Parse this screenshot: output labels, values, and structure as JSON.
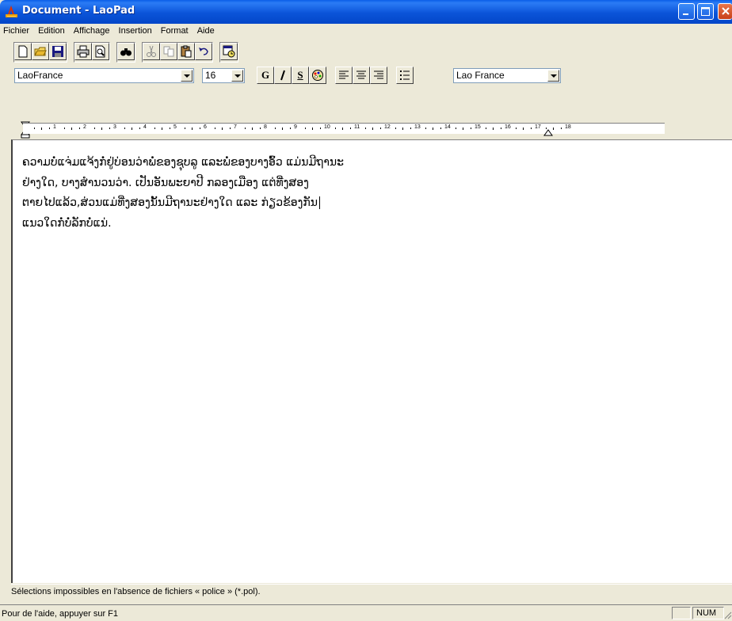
{
  "window": {
    "title": "Document - LaoPad"
  },
  "menu": [
    "Fichier",
    "Edition",
    "Affichage",
    "Insertion",
    "Format",
    "Aide"
  ],
  "toolbar": {
    "icons": [
      "new-document-icon",
      "open-folder-icon",
      "save-icon",
      "print-icon",
      "print-preview-icon",
      "find-icon",
      "cut-icon",
      "copy-icon",
      "paste-icon",
      "undo-icon",
      "insert-datetime-icon"
    ]
  },
  "format": {
    "font_name": "LaoFrance",
    "font_size": "16",
    "bold_label": "G",
    "italic_label": "I",
    "underline_label": "S",
    "keyboard": "Lao France"
  },
  "ruler": {
    "ticks": [
      "1",
      "2",
      "3",
      "4",
      "5",
      "6",
      "7",
      "8",
      "9",
      "10",
      "11",
      "12",
      "13",
      "14",
      "15",
      "16",
      "17",
      "18"
    ]
  },
  "document": {
    "lines": [
      "ຄວາມບໍ່ແຈ່ມແຈ້ງກໍ່ຢູ່ບ່ອນວ່າພໍ່ຂອງຊຸບລູ ແລະພໍ່ຂອງບາງອົ້ວ ແມ່ນມີຖານະ",
      "ຢ່າງໃດ, ບາງສຳນວນວ່າ. ເປັນອັນພະຍາປີ ກລອງເມືອງ ແຕ່ທີ່ງສອງ",
      "ຕາຍໄປແລ້ວ,ສ່ວນແມ່ທີ່ງສອງນັ້ນມີຖານະຢ່າງໃດ ແລະ ກ່ຽວຂ້ອງກັນ",
      "ແນວໃດກໍ່ບໍ່ລັກບໍ່ແນ່."
    ]
  },
  "messages": {
    "hint": "Sélections impossibles en l'absence de fichiers « police » (*.pol).",
    "status": "Pour de l'aide, appuyer sur F1",
    "num": "NUM"
  }
}
